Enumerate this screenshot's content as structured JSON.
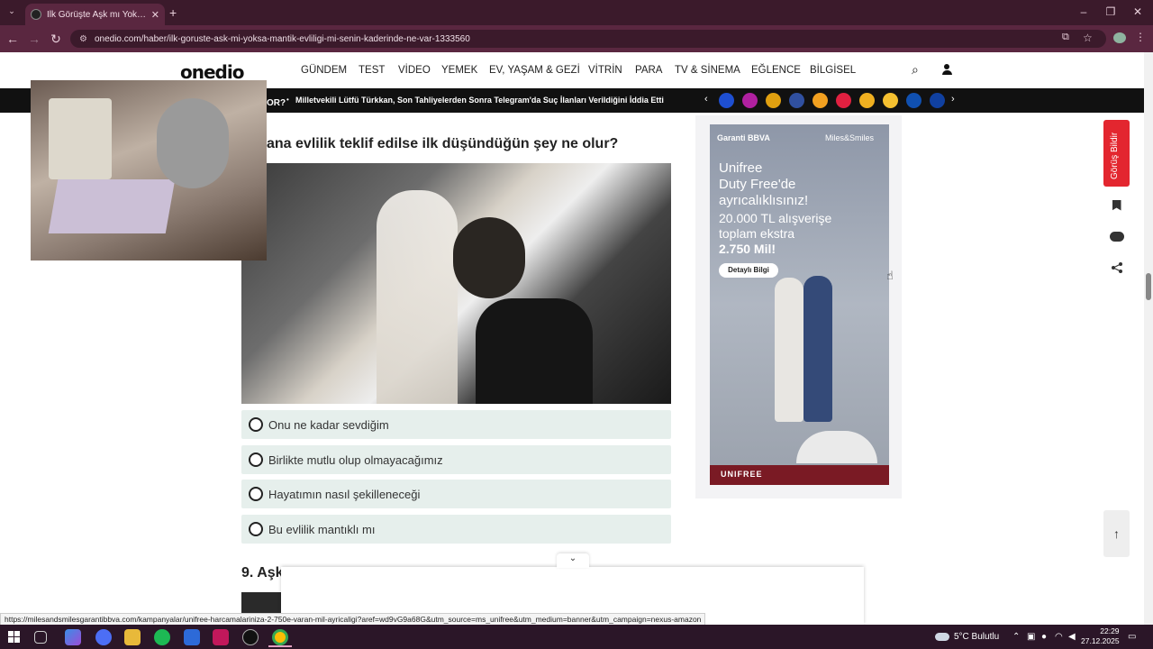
{
  "browser": {
    "tab_title": "İlk Görüşte Aşk mı Yoksa Mantık",
    "tab_close": "✕",
    "new_tab": "+",
    "url": "onedio.com/haber/ilk-goruste-ask-mi-yoksa-mantik-evliligi-mi-senin-kaderinde-ne-var-1333560"
  },
  "site": {
    "logo": "onedio",
    "nav": [
      "GÜNDEM",
      "TEST",
      "VİDEO",
      "YEMEK",
      "EV, YAŞAM & GEZİ",
      "VİTRİN",
      "PARA",
      "TV & SİNEMA",
      "EĞLENCE",
      "BİLGİSEL"
    ],
    "ticker_label": "OR?",
    "ticker_text": "Milletvekili Lütfü Türkkan, Son Tahliyelerden Sonra Telegram'da Suç İlanları Verildiğini İddia Etti",
    "emoji_colors": [
      "#1e4fd1",
      "#b020a0",
      "#e0a010",
      "#3050a0",
      "#f2a020",
      "#e02040",
      "#f0b020",
      "#f5c030",
      "#1050b0",
      "#1040a0"
    ]
  },
  "quiz": {
    "question": "ana evlilik teklif edilse ilk düşündüğün şey ne olur?",
    "options": [
      "Onu ne kadar sevdiğim",
      "Birlikte mutlu olup olmayacağımız",
      "Hayatımın nasıl şekilleneceği",
      "Bu evlilik mantıklı mı"
    ],
    "next_section": "9. Aşk"
  },
  "ad": {
    "brand": "Garanti BBVA",
    "brand2": "Miles&Smiles",
    "lines": [
      "Unifree",
      "Duty Free'de",
      "ayrıcalıklısınız!",
      "20.000 TL alışverişe",
      "toplam ekstra"
    ],
    "highlight": "2.750 Mil!",
    "button": "Detaylı Bilgi",
    "footer": "UNIFREE"
  },
  "side": {
    "feedback": "Görüş Bildir",
    "bookmark_icon": "bookmark-icon",
    "comment_icon": "comment-icon",
    "share_icon": "share-icon",
    "top_arrow": "↑"
  },
  "status_url": "https://milesandsmilesgarantibbva.com/kampanyalar/unifree-harcamalariniza-2-750e-varan-mil-ayricaligi?aref=wd9vG9a68G&utm_source=ms_unifree&utm_medium=banner&utm_campaign=nexus-amazon",
  "taskbar": {
    "weather": "5°C  Bulutlu",
    "time": "22:29",
    "date": "27.12.2025"
  }
}
